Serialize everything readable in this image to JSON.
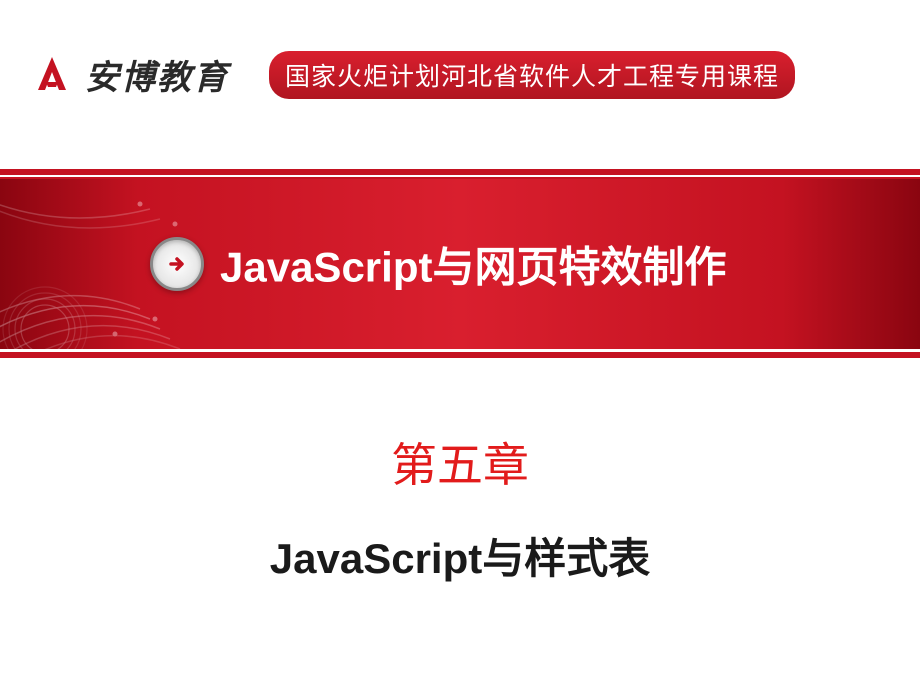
{
  "header": {
    "logo_text": "安博教育",
    "banner_text": "国家火炬计划河北省软件人才工程专用课程"
  },
  "title_section": {
    "main_title": "JavaScript与网页特效制作"
  },
  "chapter": {
    "title": "第五章",
    "subtitle": "JavaScript与样式表"
  },
  "colors": {
    "brand_red": "#c41221",
    "chapter_red": "#e21b1b",
    "text_dark": "#1a1a1a"
  }
}
